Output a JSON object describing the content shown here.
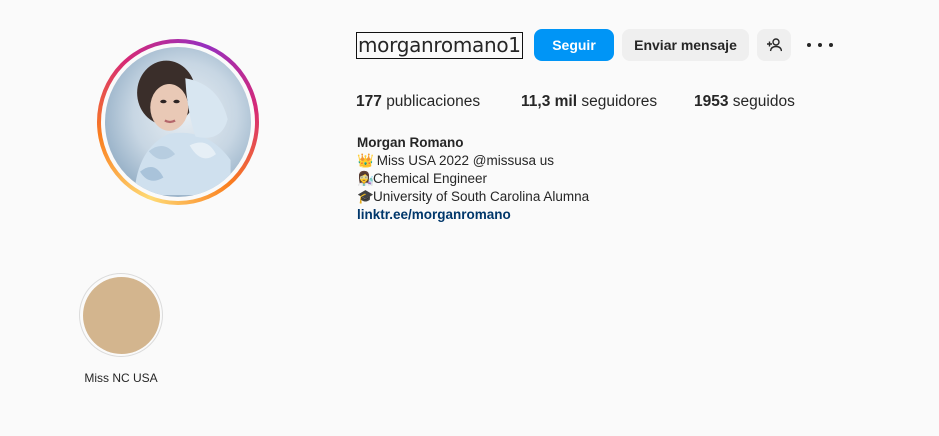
{
  "profile": {
    "username": "morganromano1",
    "follow_label": "Seguir",
    "message_label": "Enviar mensaje",
    "icons": {
      "suggest": "add-person-icon",
      "more": "more-options-icon"
    }
  },
  "stats": {
    "posts_count": "177",
    "posts_label": "publicaciones",
    "followers_count": "11,3 mil",
    "followers_label": "seguidores",
    "following_count": "1953",
    "following_label": "seguidos"
  },
  "bio": {
    "name": "Morgan Romano",
    "line1_emoji": "👑",
    "line1_text": " Miss USA 2022 ",
    "line1_mention": "@missusa",
    "line1_suffix": " us",
    "line2_emoji": "👩‍🔬",
    "line2_text": "Chemical Engineer",
    "line3_emoji": "🎓",
    "line3_text": "University of South Carolina Alumna",
    "link": "linktr.ee/morganromano"
  },
  "highlights": [
    {
      "label": "Miss NC USA",
      "color": "#d3b58e"
    }
  ],
  "colors": {
    "accent": "#0095f6",
    "link": "#00376b",
    "background": "#fafafa"
  }
}
